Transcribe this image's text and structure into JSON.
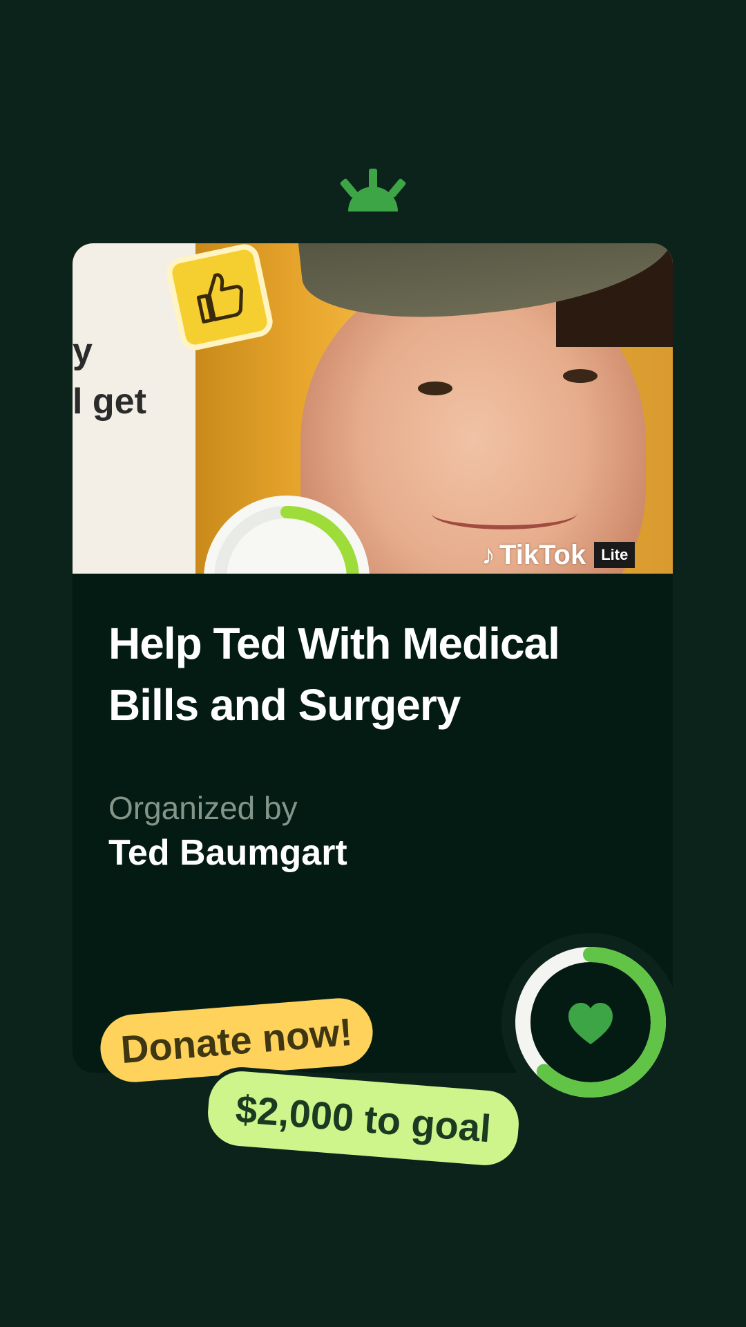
{
  "brand": {
    "logo_icon": "sunrise-logo-icon",
    "accent_color": "#3ea547"
  },
  "campaign": {
    "photo": {
      "thumb_icon": "thumbs-up-icon",
      "text_fragment_1": "y",
      "text_fragment_2": "l get",
      "watermark": "TikTok",
      "watermark_badge": "Lite"
    },
    "title": "Help Ted With Medical Bills and Surgery",
    "organizer_label": "Organized by",
    "organizer_name": "Ted Baumgart",
    "progress_icon": "heart-icon",
    "progress_fraction": 0.62
  },
  "cta": {
    "donate_label": "Donate now!",
    "goal_label": "$2,000 to goal"
  },
  "colors": {
    "background": "#0b231a",
    "card": "#031b12",
    "donate_pill": "#ffd35b",
    "goal_pill": "#cdf58c",
    "ring_track": "#f4f4f1",
    "ring_fill": "#6fcf4a",
    "heart": "#3ea547"
  }
}
